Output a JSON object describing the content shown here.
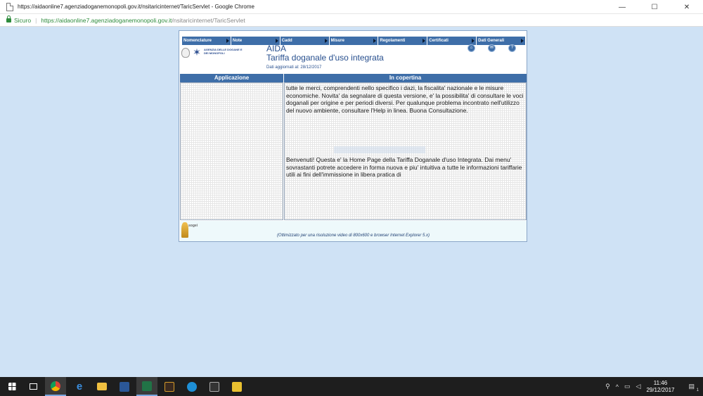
{
  "browser": {
    "window_title": "https://aidaonline7.agenziadoganemonopoli.gov.it/nsitaricinternet/TaricServlet - Google Chrome",
    "secure_label": "Sicuro",
    "url_host": "https://aidaonline7.agenziadoganemonopoli.gov.it",
    "url_path": "/nsitaricinternet/TaricServlet",
    "minimize": "—",
    "maximize": "☐",
    "close": "✕"
  },
  "menu": {
    "items": [
      {
        "label": "Nomenclature"
      },
      {
        "label": "Note"
      },
      {
        "label": "Cadd"
      },
      {
        "label": "Misure"
      },
      {
        "label": "Regolamenti"
      },
      {
        "label": "Certificati"
      },
      {
        "label": "Dati Generali"
      }
    ]
  },
  "header": {
    "agency_text": "AGENZIA DELLE DOGANE E DEI MONOPOLI",
    "app_name": "AIDA",
    "app_subtitle": "Tariffa doganale d'uso integrata",
    "updated": "Dati aggiornati al: 28/12/2017",
    "home_icon": "home-icon",
    "mail_icon": "mail-icon",
    "help_icon": "help-icon"
  },
  "columns": {
    "left": "Applicazione",
    "right": "In copertina"
  },
  "content": {
    "para_top": "tutte le merci, comprendenti nello specifico i dazi, la fiscalita' nazionale e le misure economiche. Novita' da segnalare di questa versione, e' la possibilita' di consultare le voci doganali per origine e per periodi diversi. Per qualunque problema incontrato nell'utilizzo del nuovo ambiente, consultare l'Help in linea. Buona Consultazione.",
    "para_bottom": "Benvenuti! Questa e' la Home Page della Tariffa Doganale d'uso Integrata. Dai menu' sovrastanti potrete accedere in forma nuova e piu' intuitiva a tutte le informazioni tariffarie utili ai fini dell'immissione in libera pratica di"
  },
  "footer": {
    "logo_text": "sogei",
    "note": "(Ottimizzato per una risoluzione video di 800x600 e browser Internet Explorer 5.x)"
  },
  "taskbar": {
    "time": "11:46",
    "date": "29/12/2017",
    "notification_count": "1"
  },
  "colors": {
    "menu_bar": "#3e6ea8",
    "title_text": "#274f8e",
    "page_bg": "#cfe2f5",
    "secure_green": "#2e8b3c"
  }
}
